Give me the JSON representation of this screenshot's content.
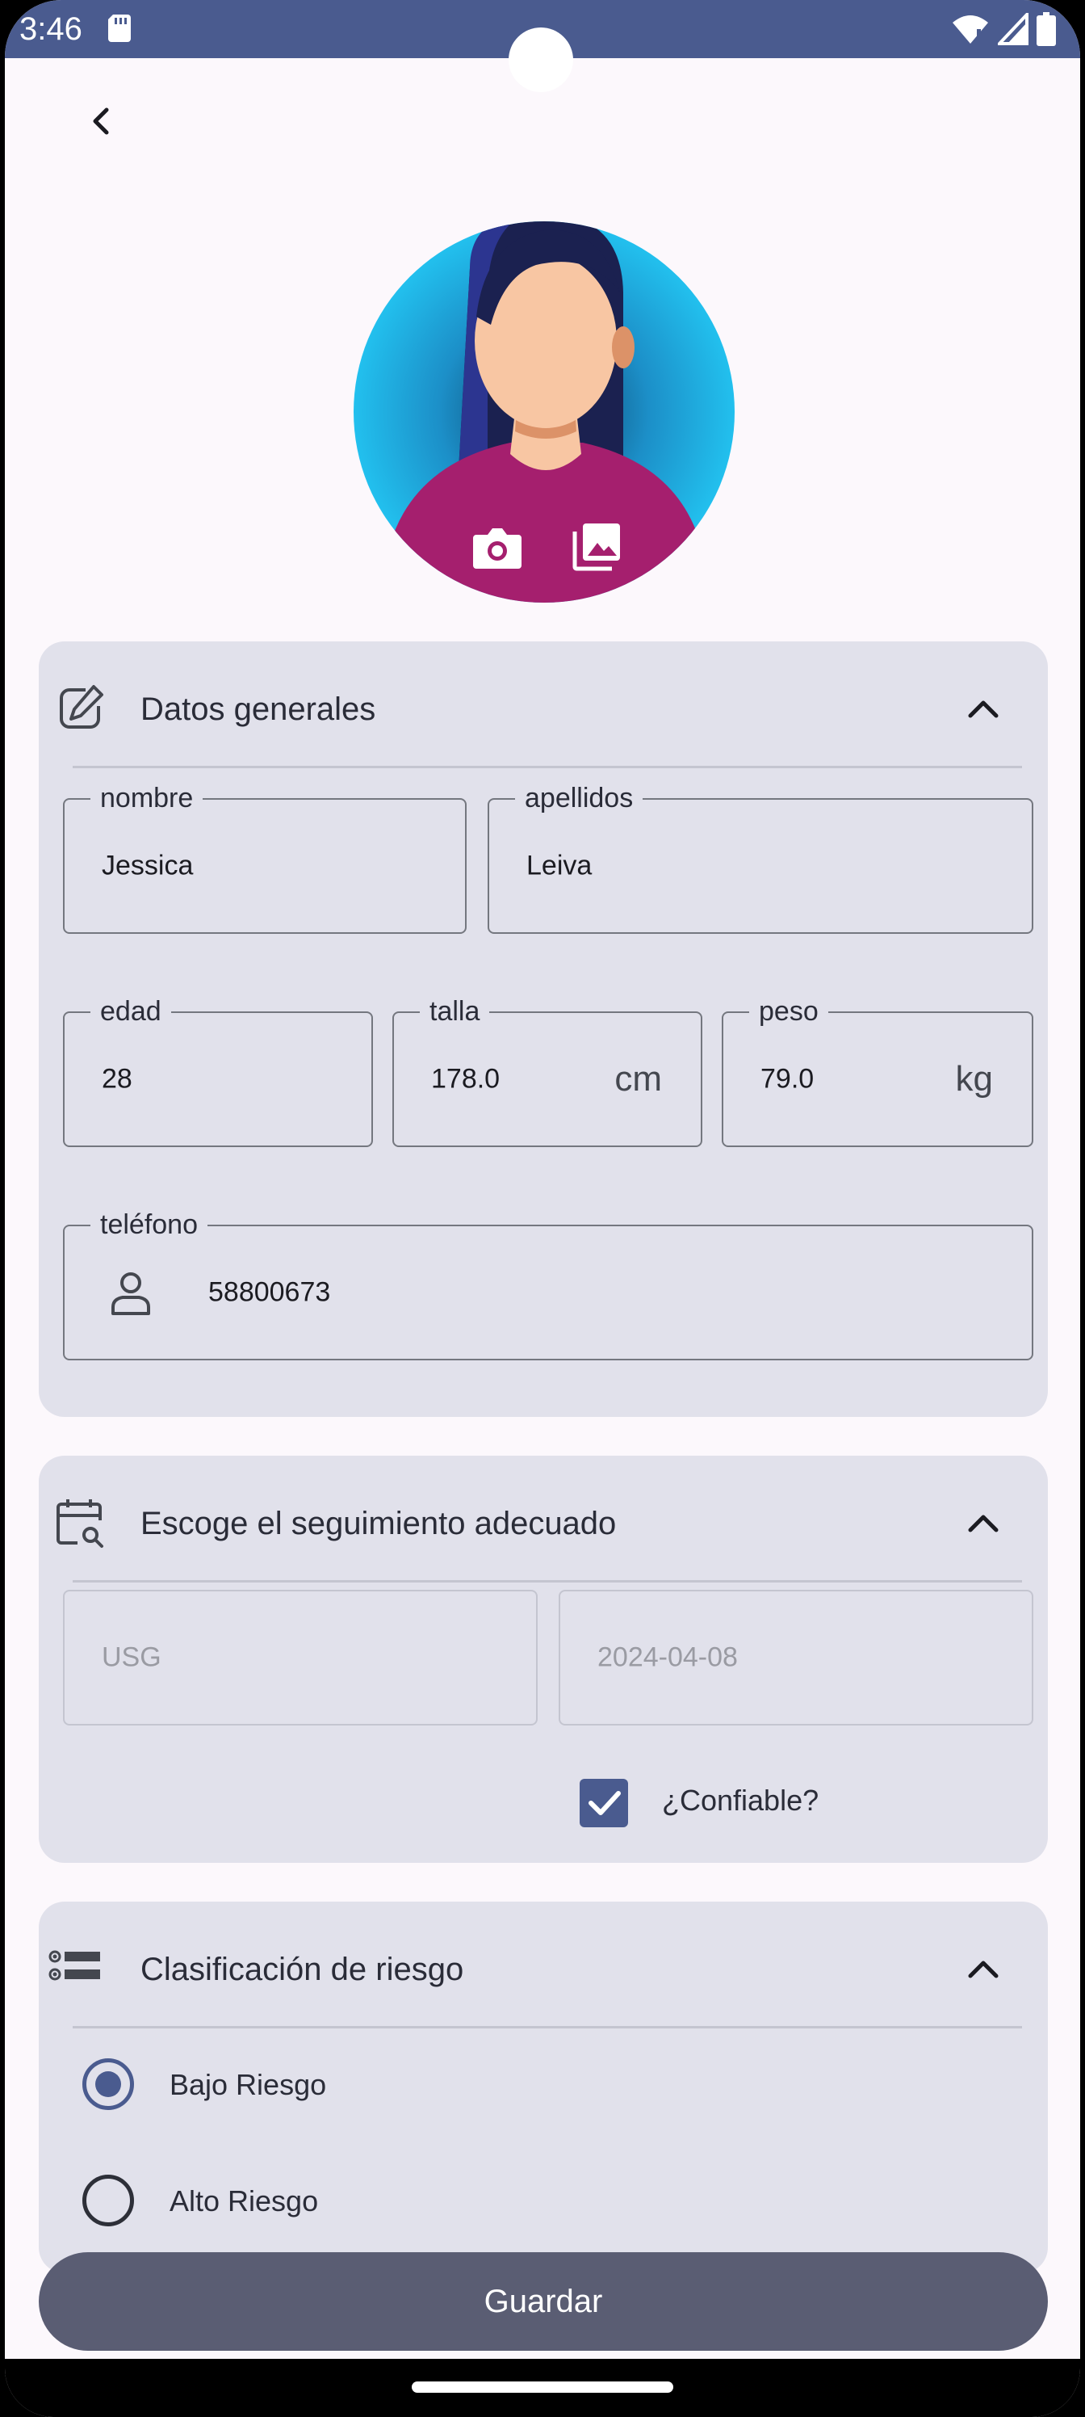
{
  "status_bar": {
    "time": "3:46"
  },
  "icons": {
    "back": "arrow-back-icon",
    "camera": "camera-icon",
    "gallery": "gallery-icon",
    "edit": "edit-icon",
    "calendar": "calendar-search-icon",
    "list": "list-icon",
    "person": "person-icon",
    "chevron": "chevron-up-icon",
    "check": "check-icon"
  },
  "general": {
    "title": "Datos generales",
    "nombre": {
      "label": "nombre",
      "value": "Jessica"
    },
    "apellidos": {
      "label": "apellidos",
      "value": "Leiva"
    },
    "edad": {
      "label": "edad",
      "value": "28"
    },
    "talla": {
      "label": "talla",
      "value": "178.0",
      "suffix": "cm"
    },
    "peso": {
      "label": "peso",
      "value": "79.0",
      "suffix": "kg"
    },
    "telefono": {
      "label": "teléfono",
      "value": "58800673"
    }
  },
  "seguimiento": {
    "title": "Escoge el seguimiento adecuado",
    "tipo": "USG",
    "fecha": "2024-04-08",
    "confiable_label": "¿Confiable?",
    "confiable_checked": true
  },
  "riesgo": {
    "title": "Clasificación de riesgo",
    "options": [
      {
        "label": "Bajo Riesgo",
        "selected": true
      },
      {
        "label": "Alto Riesgo",
        "selected": false
      }
    ]
  },
  "actions": {
    "save_label": "Guardar"
  },
  "colors": {
    "primary": "#4a5b8f",
    "card_bg": "#e1e1eb",
    "button_bg": "#5a5d73"
  }
}
